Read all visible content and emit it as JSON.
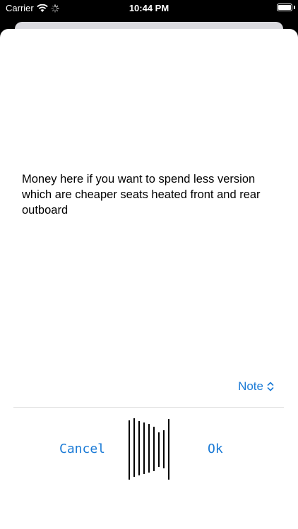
{
  "status_bar": {
    "carrier": "Carrier",
    "time": "10:44 PM"
  },
  "note": {
    "text": "Money here if you want to spend less version which are cheaper seats heated front and rear outboard"
  },
  "note_selector": {
    "label": "Note",
    "icon": "chevron-up-down-icon"
  },
  "actions": {
    "cancel_label": "Cancel",
    "ok_label": "Ok"
  },
  "colors": {
    "accent": "#1a7ad6",
    "background": "#ffffff"
  }
}
